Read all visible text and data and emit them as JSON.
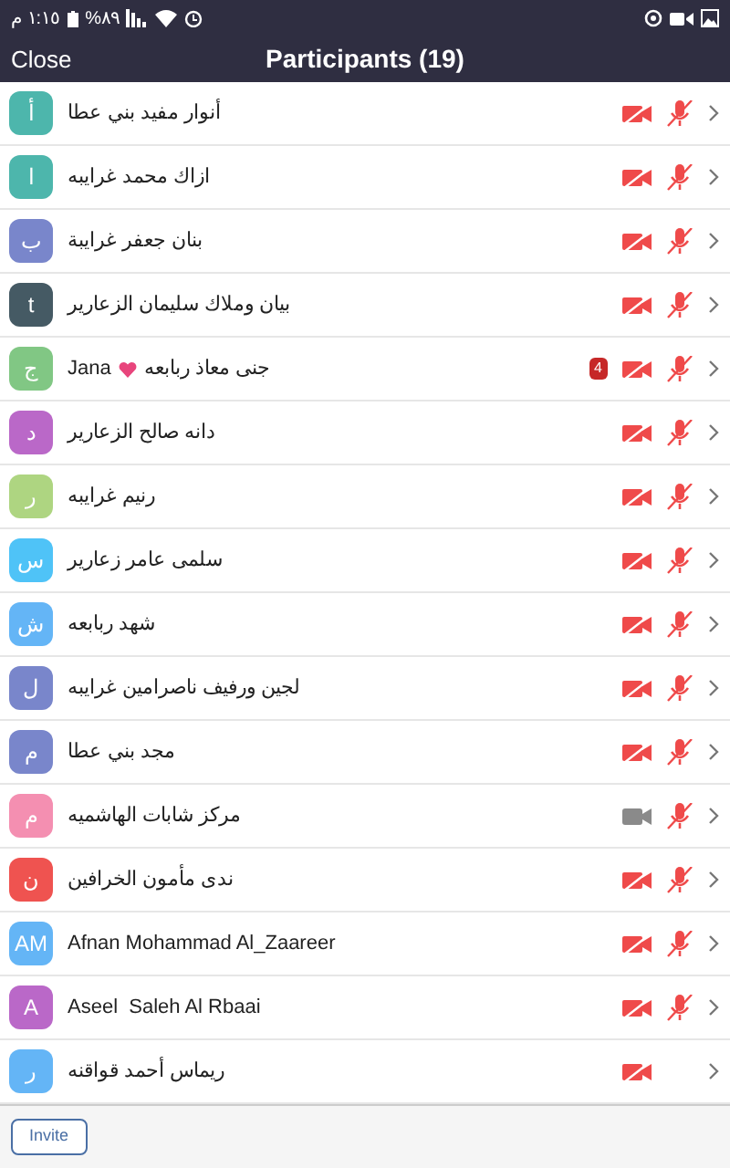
{
  "status_bar": {
    "time": "١:١٥ م",
    "battery": "%٨٩"
  },
  "header": {
    "close": "Close",
    "title": "Participants (19)"
  },
  "participants": [
    {
      "initial": "أ",
      "color": "#4db6ac",
      "name": "أنوار مفيد بني عطا",
      "video_off": true,
      "mic_muted": true
    },
    {
      "initial": "ا",
      "color": "#4db6ac",
      "name": "ازاك محمد غرايبه",
      "video_off": true,
      "mic_muted": true
    },
    {
      "initial": "ب",
      "color": "#7986cb",
      "name": "بنان جعفر غرايبة",
      "video_off": true,
      "mic_muted": true
    },
    {
      "initial": "t",
      "color": "#455a64",
      "name": "بيان وملاك سليمان الزعارير",
      "video_off": true,
      "mic_muted": true
    },
    {
      "initial": "ج",
      "color": "#81c784",
      "prefix": "Jana",
      "heart": true,
      "name": "جنى معاذ ربابعه",
      "badge": "4",
      "video_off": true,
      "mic_muted": true
    },
    {
      "initial": "د",
      "color": "#ba68c8",
      "name": "دانه صالح الزعارير",
      "video_off": true,
      "mic_muted": true
    },
    {
      "initial": "ر",
      "color": "#aed581",
      "name": "رنيم غرايبه",
      "video_off": true,
      "mic_muted": true
    },
    {
      "initial": "س",
      "color": "#4fc3f7",
      "name": "سلمى عامر زعارير",
      "video_off": true,
      "mic_muted": true
    },
    {
      "initial": "ش",
      "color": "#64b5f6",
      "name": "شهد ربابعه",
      "video_off": true,
      "mic_muted": true
    },
    {
      "initial": "ل",
      "color": "#7986cb",
      "name": "لجين ورفيف ناصرامين غرايبه",
      "video_off": true,
      "mic_muted": true
    },
    {
      "initial": "م",
      "color": "#7986cb",
      "name": "مجد بني عطا",
      "video_off": true,
      "mic_muted": true
    },
    {
      "initial": "م",
      "color": "#f48fb1",
      "name": "مركز شابات الهاشميه",
      "video_off": false,
      "mic_muted": true
    },
    {
      "initial": "ن",
      "color": "#ef5350",
      "name": "ندى مأمون الخرافين",
      "video_off": true,
      "mic_muted": true
    },
    {
      "initial": "AM",
      "color": "#64b5f6",
      "name": "Afnan Mohammad Al_Zaareer",
      "video_off": true,
      "mic_muted": true
    },
    {
      "initial": "A",
      "color": "#ba68c8",
      "name": "Aseel  Saleh Al Rbaai",
      "video_off": true,
      "mic_muted": true
    },
    {
      "initial": "ر",
      "color": "#64b5f6",
      "name": "ريماس أحمد قواقنه",
      "video_off": true,
      "mic_muted": false
    }
  ],
  "footer": {
    "invite": "Invite"
  }
}
